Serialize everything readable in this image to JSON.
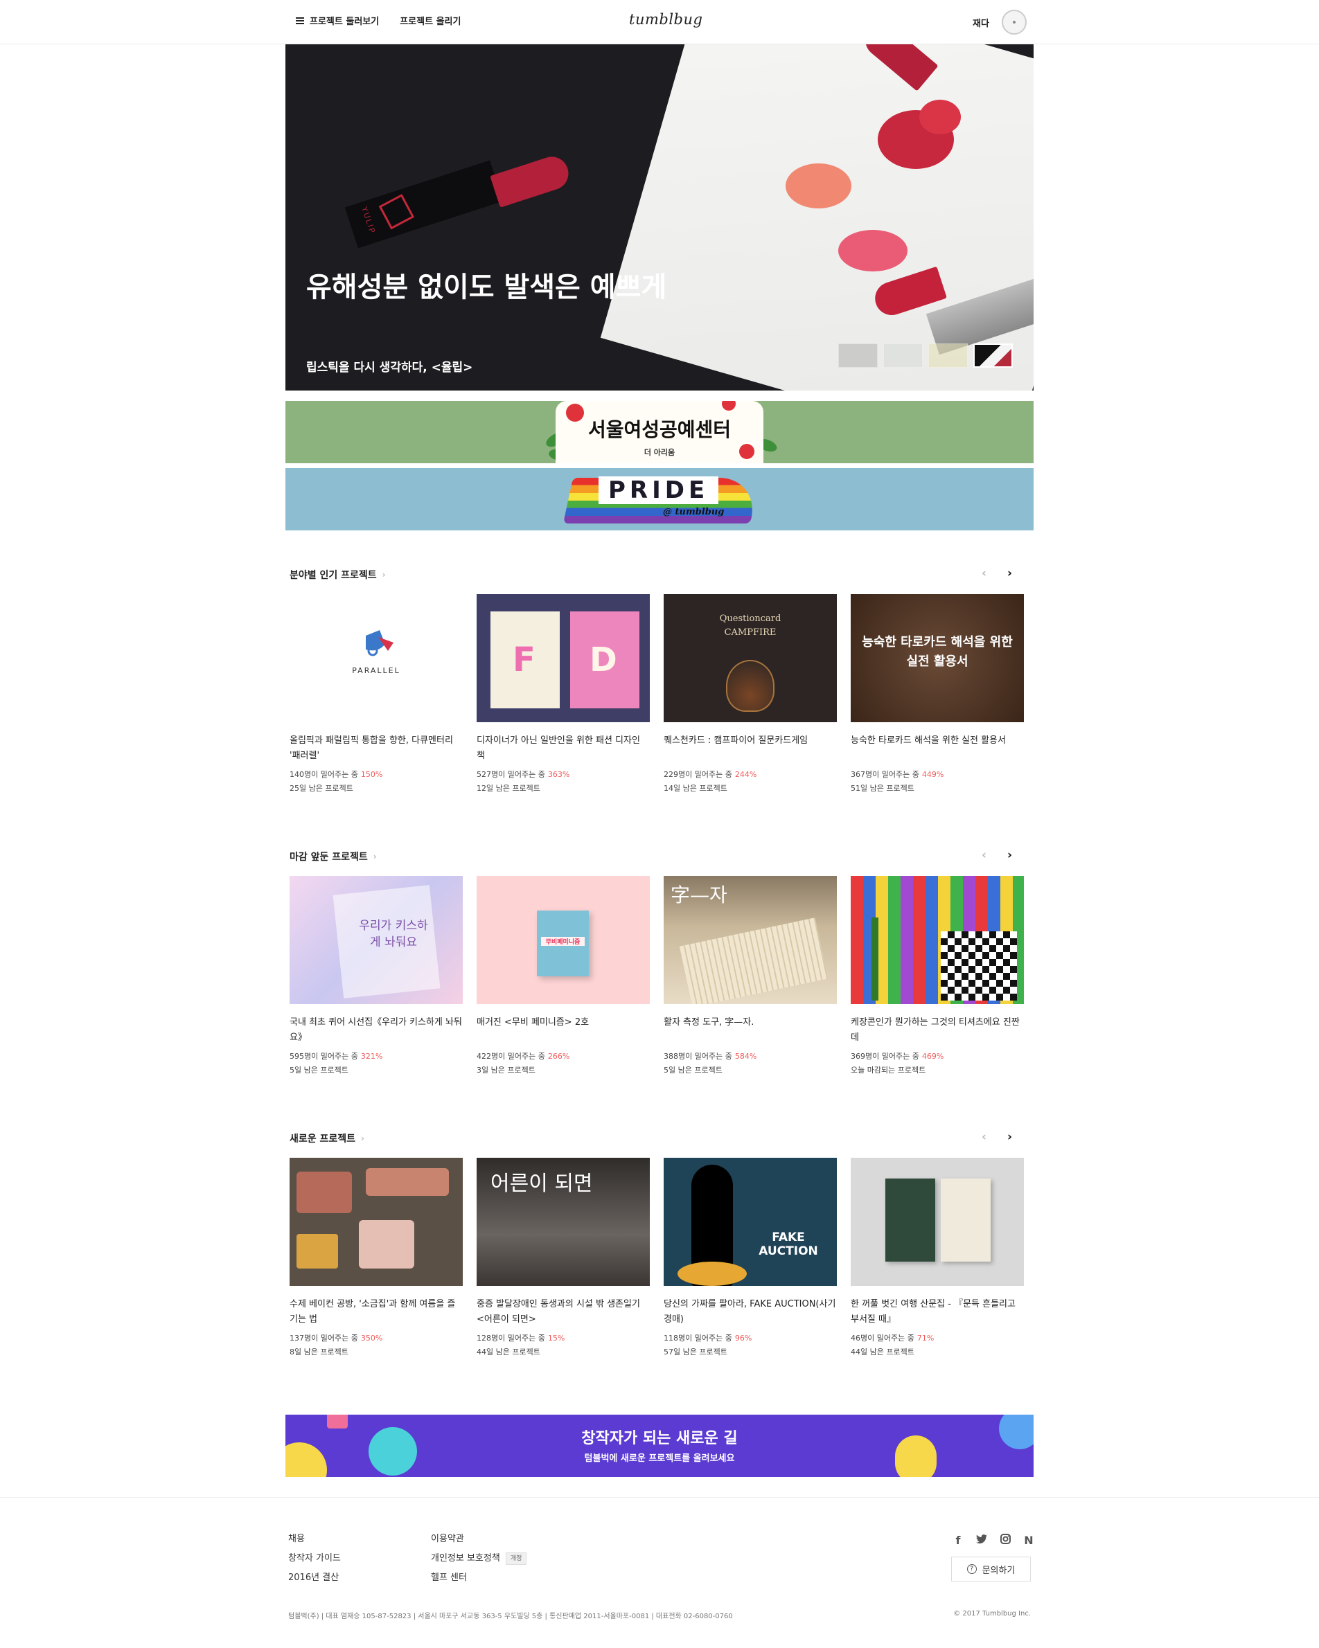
{
  "header": {
    "browse_label": "프로젝트 둘러보기",
    "upload_label": "프로젝트 올리기",
    "logo": "tumblbug",
    "user_name": "재다"
  },
  "hero": {
    "title": "유해성분 없이도 발색은 예쁘게",
    "subtitle": "립스틱을 다시 생각하다, <율립>",
    "lipstick_brand": "YULIP",
    "slides": [
      {
        "color": "#b7b7b7",
        "active": false
      },
      {
        "color": "#d9dcd9",
        "active": false
      },
      {
        "color": "#e4e2b8",
        "active": false
      },
      {
        "color": "#b52a3a",
        "active": true
      }
    ]
  },
  "banners": {
    "seoul": {
      "title": "서울여성공예센터",
      "sub": "더 아리움",
      "background": "#8cb37d"
    },
    "pride": {
      "title": "PRIDE",
      "tag": "@ tumblbug",
      "background": "#8dbdd1"
    }
  },
  "sections": [
    {
      "title": "분야별 인기 프로젝트",
      "cards": [
        {
          "title": "올림픽과 패럴림픽 통합을 향한, 다큐멘터리 '패러렐'",
          "supporters": "140명이 밀어주는 중",
          "percent": "150%",
          "remaining": "25일 남은 프로젝트",
          "thumb_text": "PARALLEL"
        },
        {
          "title": "디자이너가 아닌 일반인을 위한 패션 디자인 책",
          "supporters": "527명이 밀어주는 중",
          "percent": "363%",
          "remaining": "12일 남은 프로젝트",
          "thumb_text": "F D"
        },
        {
          "title": "퀘스천카드 : 캠프파이어 질문카드게임",
          "supporters": "229명이 밀어주는 중",
          "percent": "244%",
          "remaining": "14일 남은 프로젝트",
          "thumb_text": "Questioncard CAMPFIRE"
        },
        {
          "title": "능숙한 타로카드 해석을 위한 실전 활용서",
          "supporters": "367명이 밀어주는 중",
          "percent": "449%",
          "remaining": "51일 남은 프로젝트",
          "thumb_text": "능숙한 타로카드 해석을 위한 실전 활용서"
        }
      ]
    },
    {
      "title": "마감 앞둔 프로젝트",
      "cards": [
        {
          "title": "국내 최초 퀴어 시선집《우리가 키스하게 놔둬요》",
          "supporters": "595명이 밀어주는 중",
          "percent": "321%",
          "remaining": "5일 남은 프로젝트",
          "thumb_text": "우리가 키스하게 놔둬요"
        },
        {
          "title": "매거진 <무비 페미니즘> 2호",
          "supporters": "422명이 밀어주는 중",
          "percent": "266%",
          "remaining": "3일 남은 프로젝트",
          "thumb_text": "무비페미니즘"
        },
        {
          "title": "활자 측정 도구, 字—자.",
          "supporters": "388명이 밀어주는 중",
          "percent": "584%",
          "remaining": "5일 남은 프로젝트",
          "thumb_text": "字—자"
        },
        {
          "title": "케장콘인가 뭔가하는 그것의 티셔츠에요 진짠데",
          "supporters": "369명이 밀어주는 중",
          "percent": "469%",
          "remaining": "오늘 마감되는 프로젝트",
          "thumb_text": ""
        }
      ]
    },
    {
      "title": "새로운 프로젝트",
      "cards": [
        {
          "title": "수제 베이컨 공방, '소금집'과 함께 여름을 즐기는 법",
          "supporters": "137명이 밀어주는 중",
          "percent": "350%",
          "remaining": "8일 남은 프로젝트",
          "thumb_text": ""
        },
        {
          "title": "중증 발달장애인 동생과의 시설 밖 생존일기 <어른이 되면>",
          "supporters": "128명이 밀어주는 중",
          "percent": "15%",
          "remaining": "44일 남은 프로젝트",
          "thumb_text": "어른이 되면"
        },
        {
          "title": "당신의 가짜를 팔아라, FAKE AUCTION(사기경매)",
          "supporters": "118명이 밀어주는 중",
          "percent": "96%",
          "remaining": "57일 남은 프로젝트",
          "thumb_text": "FAKE AUCTION"
        },
        {
          "title": "한 꺼풀 벗긴 여행 산문집 - 『문득 흔들리고 부서질 때』",
          "supporters": "46명이 밀어주는 중",
          "percent": "71%",
          "remaining": "44일 남은 프로젝트",
          "thumb_text": ""
        }
      ]
    }
  ],
  "creator_banner": {
    "title": "창작자가 되는 새로운 길",
    "subtitle": "텀블벅에 새로운 프로젝트를 올려보세요"
  },
  "footer": {
    "col1": [
      "채용",
      "창작자 가이드",
      "2016년 결산"
    ],
    "col2": [
      "이용약관",
      "개인정보 보호정책",
      "헬프 센터"
    ],
    "policy_badge": "개정",
    "contact_label": "문의하기",
    "info": "텀블벅(주) | 대표 염재승 105-87-52823 | 서울시 마포구 서교동 363-5 우도빌딩 5층 | 통신판매업 2011-서울마포-0081 | 대표전화 02-6080-0760",
    "copyright": "© 2017 Tumblbug Inc.",
    "social_icons": [
      "facebook-icon",
      "twitter-icon",
      "instagram-icon",
      "naver-icon"
    ]
  }
}
